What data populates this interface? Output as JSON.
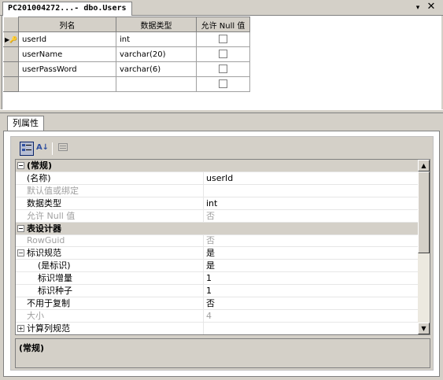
{
  "document_tab": {
    "title": "PC201004272...- dbo.Users",
    "dropdown_glyph": "▾",
    "close_glyph": "✕"
  },
  "grid": {
    "headers": [
      "列名",
      "数据类型",
      "允许 Null 值"
    ],
    "rows": [
      {
        "name": "userId",
        "type": "int",
        "allow_null": false,
        "primary_key": true
      },
      {
        "name": "userName",
        "type": "varchar(20)",
        "allow_null": false,
        "primary_key": false
      },
      {
        "name": "userPassWord",
        "type": "varchar(6)",
        "allow_null": false,
        "primary_key": false
      },
      {
        "name": "",
        "type": "",
        "allow_null": false,
        "primary_key": false
      }
    ],
    "pk_glyph": "▶🔑"
  },
  "properties": {
    "tab_label": "列属性",
    "toolbar": {
      "categorized_icon": "categorized-icon",
      "alphabetical_label": "A↓",
      "pages_icon": "property-pages-icon"
    },
    "rows": [
      {
        "kind": "cat",
        "expander": "−",
        "name": "(常规)",
        "value": ""
      },
      {
        "kind": "prop",
        "name": "(名称)",
        "value": "userId",
        "disabled": false
      },
      {
        "kind": "prop",
        "name": "默认值或绑定",
        "value": "",
        "disabled": true
      },
      {
        "kind": "prop",
        "name": "数据类型",
        "value": "int",
        "disabled": false
      },
      {
        "kind": "prop",
        "name": "允许 Null 值",
        "value": "否",
        "disabled": true
      },
      {
        "kind": "cat",
        "expander": "−",
        "name": "表设计器",
        "value": ""
      },
      {
        "kind": "prop",
        "name": "RowGuid",
        "value": "否",
        "disabled": true
      },
      {
        "kind": "sub",
        "expander": "−",
        "name": "标识规范",
        "value": "是",
        "disabled": false
      },
      {
        "kind": "child",
        "name": "(是标识)",
        "value": "是",
        "disabled": false
      },
      {
        "kind": "child",
        "name": "标识增量",
        "value": "1",
        "disabled": false
      },
      {
        "kind": "child",
        "name": "标识种子",
        "value": "1",
        "disabled": false
      },
      {
        "kind": "prop",
        "name": "不用于复制",
        "value": "否",
        "disabled": false
      },
      {
        "kind": "prop",
        "name": "大小",
        "value": "4",
        "disabled": true
      },
      {
        "kind": "sub",
        "expander": "+",
        "name": "计算列规范",
        "value": "",
        "disabled": false
      }
    ],
    "description_title": "(常规)"
  },
  "colors": {
    "selection": "#b8c6e0",
    "chrome": "#d4d0c8"
  }
}
